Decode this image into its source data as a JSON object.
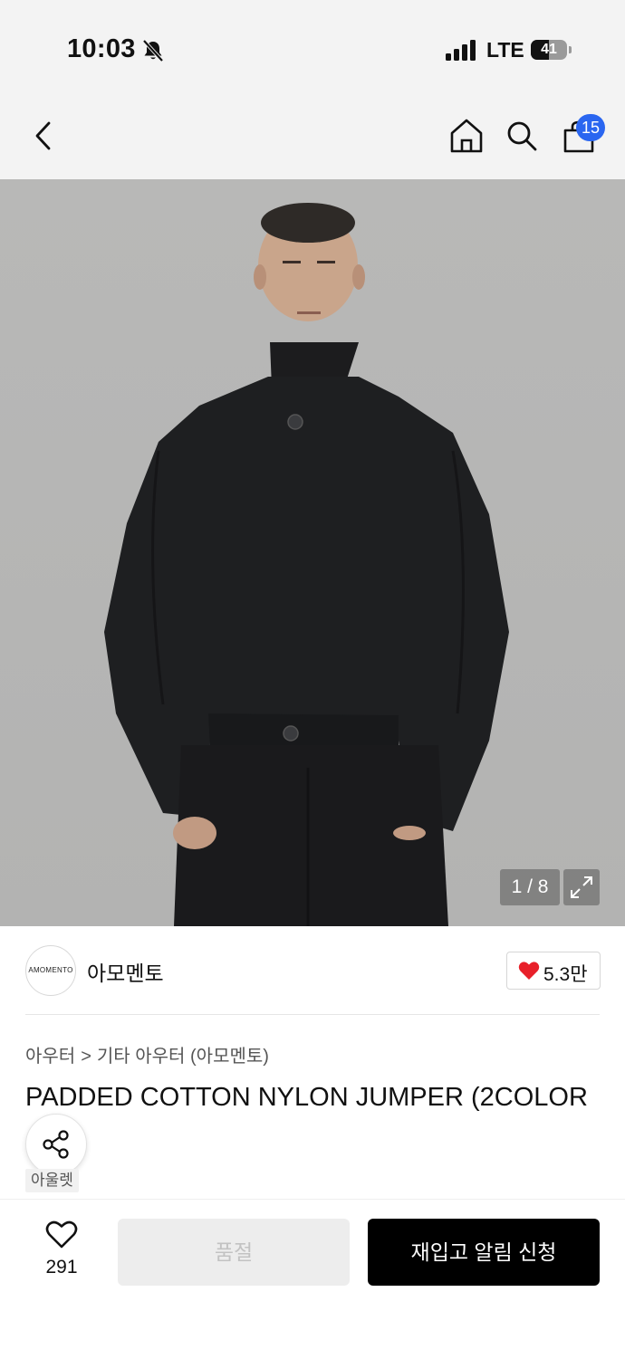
{
  "status_bar": {
    "time": "10:03",
    "network": "LTE",
    "battery": "41",
    "icons": [
      "bell-slash-icon",
      "signal-bars-icon",
      "battery-icon"
    ]
  },
  "nav": {
    "icons": [
      "back-arrow-icon",
      "home-icon",
      "search-icon",
      "shopping-bag-icon"
    ],
    "cart_count": "15",
    "cart_badge_color": "#2a66f0"
  },
  "gallery": {
    "counter": "1 / 8",
    "expand_icon": "expand-arrows-icon"
  },
  "brand": {
    "logo_text": "AMOMENTO",
    "name": "아모멘토",
    "likes": "5.3만",
    "heart_color": "#e8202a"
  },
  "breadcrumb": {
    "category": "아우터",
    "separator": ">",
    "subcategory": "기타 아우터 (아모멘토)"
  },
  "product": {
    "title": "PADDED COTTON NYLON JUMPER (2COLOR",
    "tag": "아울렛"
  },
  "actions": {
    "wish_count": "291",
    "soldout_label": "품절",
    "restock_label": "재입고 알림 신청"
  }
}
